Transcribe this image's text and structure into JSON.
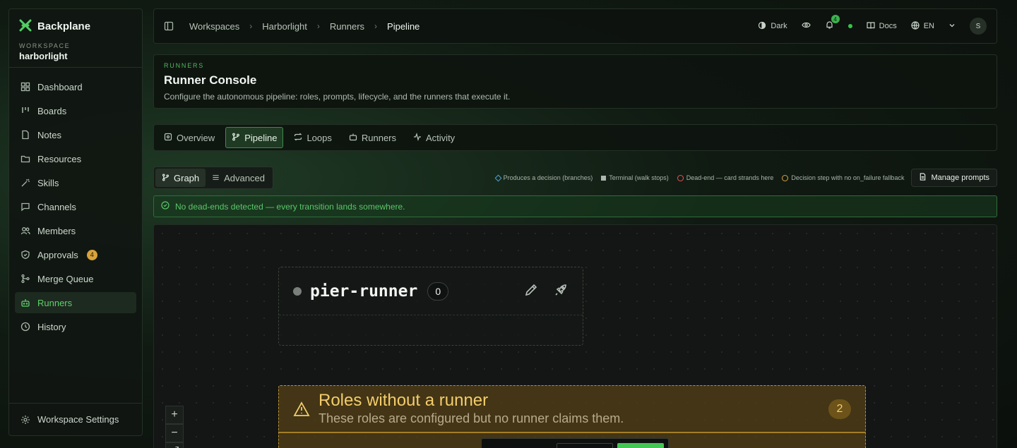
{
  "sidebar": {
    "brand": "Backplane",
    "workspace_label": "WORKSPACE",
    "workspace_name": "harborlight",
    "items": [
      {
        "label": "Dashboard"
      },
      {
        "label": "Boards"
      },
      {
        "label": "Notes"
      },
      {
        "label": "Resources"
      },
      {
        "label": "Skills"
      },
      {
        "label": "Channels"
      },
      {
        "label": "Members"
      },
      {
        "label": "Approvals",
        "badge": "4"
      },
      {
        "label": "Merge Queue"
      },
      {
        "label": "Runners",
        "active": true
      },
      {
        "label": "History"
      }
    ],
    "footer": "Workspace Settings"
  },
  "topbar": {
    "breadcrumbs": [
      "Workspaces",
      "Harborlight",
      "Runners",
      "Pipeline"
    ],
    "theme": "Dark",
    "notifications": "4",
    "docs": "Docs",
    "language": "EN",
    "avatar": "S"
  },
  "header": {
    "eyebrow": "RUNNERS",
    "title": "Runner Console",
    "subtitle": "Configure the autonomous pipeline: roles, prompts, lifecycle, and the runners that execute it."
  },
  "tabs": [
    {
      "label": "Overview"
    },
    {
      "label": "Pipeline",
      "active": true
    },
    {
      "label": "Loops"
    },
    {
      "label": "Runners"
    },
    {
      "label": "Activity"
    }
  ],
  "view_toggle": {
    "graph": "Graph",
    "advanced": "Advanced",
    "selected": "Graph"
  },
  "legend": {
    "decision": "Produces a decision (branches)",
    "terminal": "Terminal (walk stops)",
    "dead_end": "Dead-end — card strands here",
    "no_fallback": "Decision step with no on_failure fallback"
  },
  "manage_prompts": "Manage prompts",
  "alert": "No dead-ends detected — every transition lands somewhere.",
  "runner_node": {
    "name": "pier-runner",
    "count": "0"
  },
  "roles_group": {
    "title": "Roles without a runner",
    "subtitle": "These roles are configured but no runner claims them.",
    "count": "2"
  },
  "colors": {
    "accent": "#5fd06b",
    "warning": "#d9a23a",
    "danger": "#e05454",
    "info": "#4fa0d8"
  }
}
